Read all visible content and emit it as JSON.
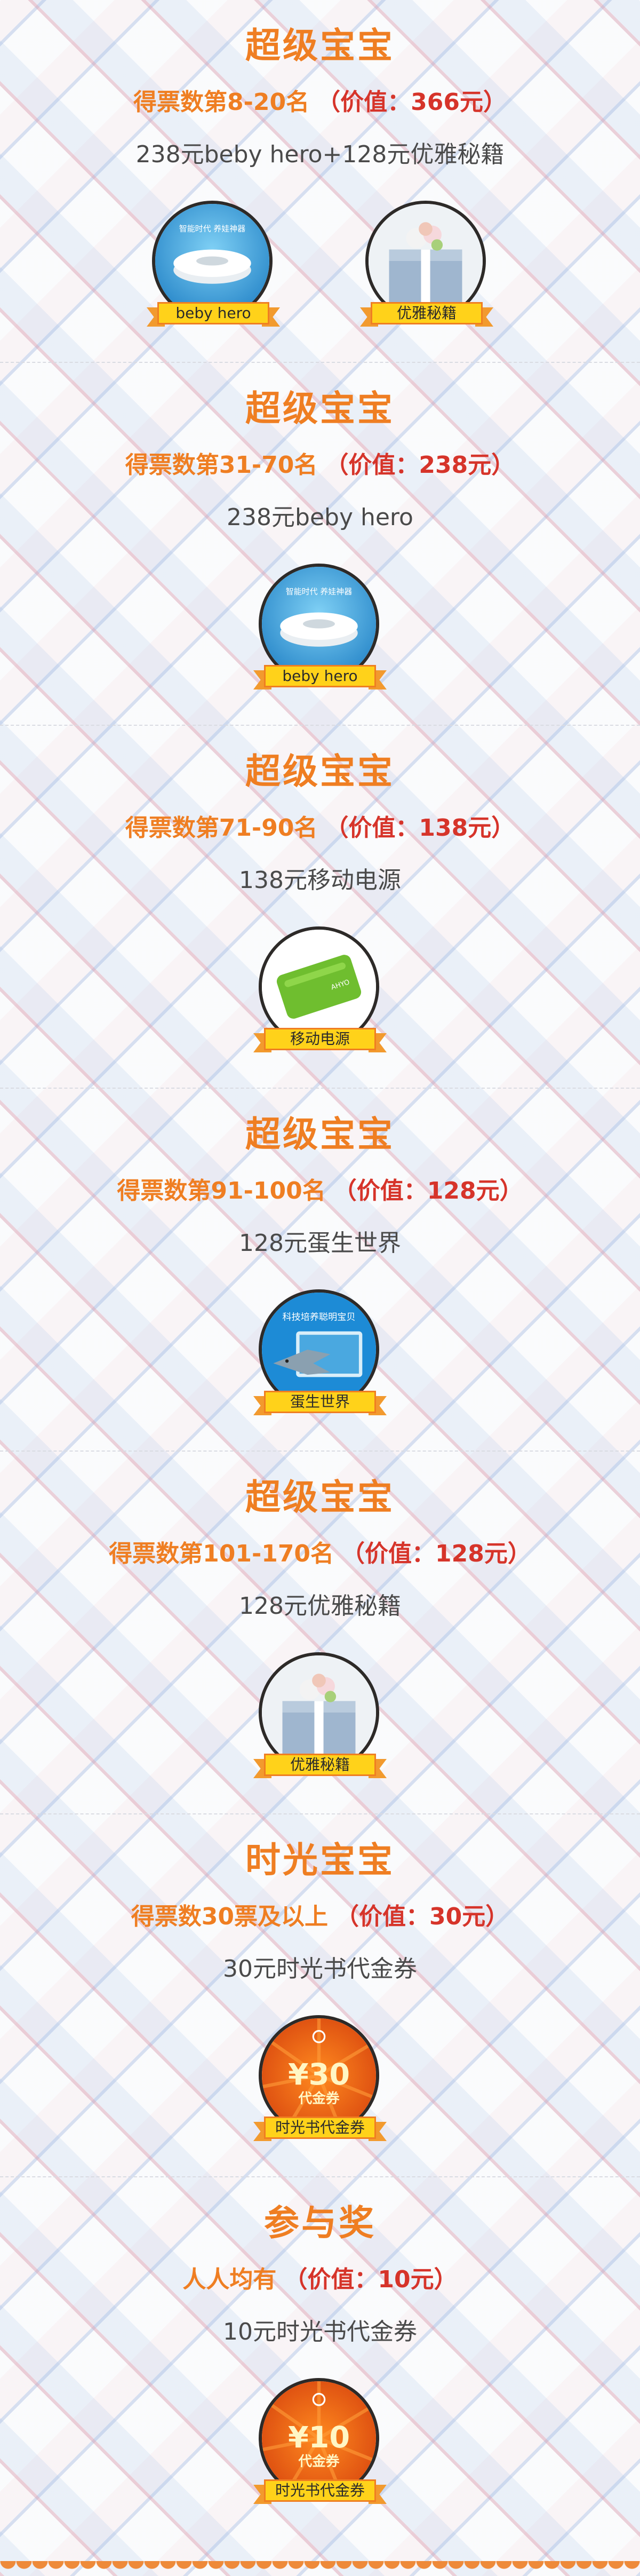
{
  "sections": [
    {
      "tier": "超级宝宝",
      "rank": "得票数第8-20名",
      "value": "（价值：366元）",
      "desc": "238元beby hero+128元优雅秘籍",
      "prizes": [
        {
          "label": "beby hero",
          "image": "air-purifier",
          "caption": "智能时代 养娃神器"
        },
        {
          "label": "优雅秘籍",
          "image": "gift-box"
        }
      ]
    },
    {
      "tier": "超级宝宝",
      "rank": "得票数第31-70名",
      "value": "（价值：238元）",
      "desc": "238元beby hero",
      "prizes": [
        {
          "label": "beby hero",
          "image": "air-purifier",
          "caption": "智能时代 养娃神器"
        }
      ]
    },
    {
      "tier": "超级宝宝",
      "rank": "得票数第71-90名",
      "value": "（价值：138元）",
      "desc": "138元移动电源",
      "prizes": [
        {
          "label": "移动电源",
          "image": "power-bank",
          "caption": "AHYO"
        }
      ]
    },
    {
      "tier": "超级宝宝",
      "rank": "得票数第91-100名",
      "value": "（价值：128元）",
      "desc": "128元蛋生世界",
      "prizes": [
        {
          "label": "蛋生世界",
          "image": "tablet-shark",
          "caption": "科技培养聪明宝贝"
        }
      ]
    },
    {
      "tier": "超级宝宝",
      "rank": "得票数第101-170名",
      "value": "（价值：128元）",
      "desc": "128元优雅秘籍",
      "prizes": [
        {
          "label": "优雅秘籍",
          "image": "gift-box"
        }
      ]
    },
    {
      "tier": "时光宝宝",
      "rank": "得票数30票及以上",
      "value": "（价值：30元）",
      "desc": "30元时光书代金券",
      "prizes": [
        {
          "label": "时光书代金券",
          "image": "coupon",
          "amount": "¥30",
          "coupon_text": "代金券"
        }
      ]
    },
    {
      "tier": "参与奖",
      "rank": "人人均有",
      "value": "（价值：10元）",
      "desc": "10元时光书代金券",
      "prizes": [
        {
          "label": "时光书代金券",
          "image": "coupon",
          "amount": "¥10",
          "coupon_text": "代金券"
        }
      ]
    }
  ],
  "colors": {
    "accent_orange": "#ef7e22",
    "value_red": "#d6342a",
    "ribbon_yellow": "#ffd21a",
    "text_dark": "#4a4a4a"
  }
}
